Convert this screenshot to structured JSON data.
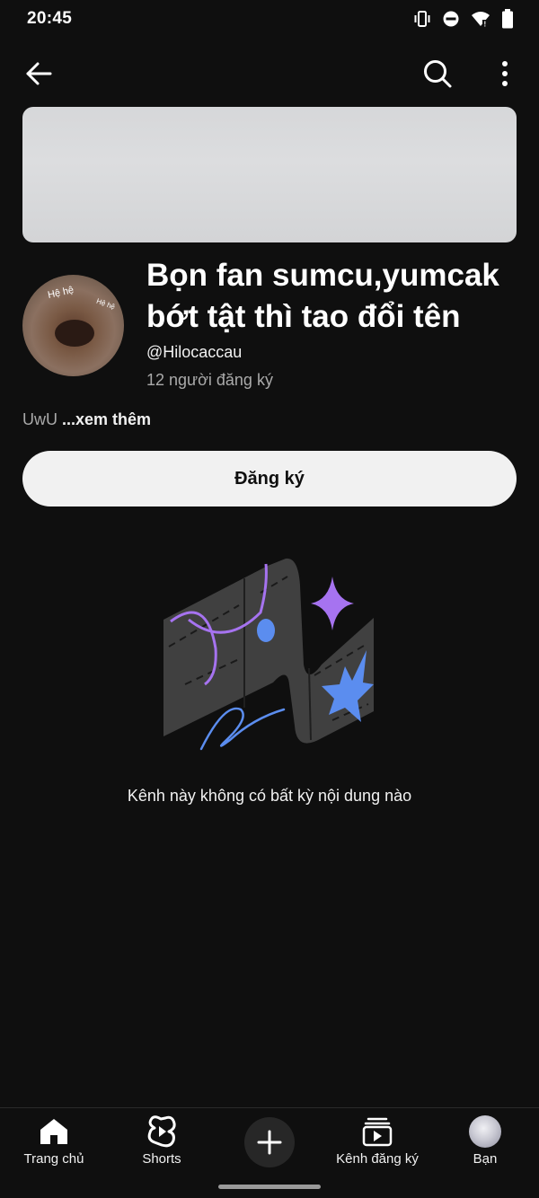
{
  "status_bar": {
    "time": "20:45",
    "icons": [
      "vibrate-icon",
      "do-not-disturb-icon",
      "wifi-icon",
      "battery-icon"
    ]
  },
  "app_bar": {
    "back_icon": "arrow-left-icon",
    "search_icon": "search-icon",
    "more_icon": "more-vert-icon"
  },
  "channel": {
    "name": "Bọn fan sumcu,yumcak bớt tật thì tao đổi tên",
    "handle": "@Hilocaccau",
    "subscribers": "12 người đăng ký",
    "description": "UwU",
    "more_label": "...xem thêm",
    "avatar_text_1": "Hệ hệ",
    "avatar_text_2": "Hệ hệ"
  },
  "subscribe_button": {
    "label": "Đăng ký"
  },
  "empty_state": {
    "message": "Kênh này không có bất kỳ nội dung nào"
  },
  "bottom_nav": {
    "home": "Trang chủ",
    "shorts": "Shorts",
    "subscriptions": "Kênh đăng ký",
    "you": "Bạn"
  },
  "colors": {
    "background": "#0f0f0f",
    "subscribe_bg": "#f1f1f1",
    "art_purple": "#a673f0",
    "art_blue": "#5b8def",
    "art_shape": "#3f3f3f"
  }
}
